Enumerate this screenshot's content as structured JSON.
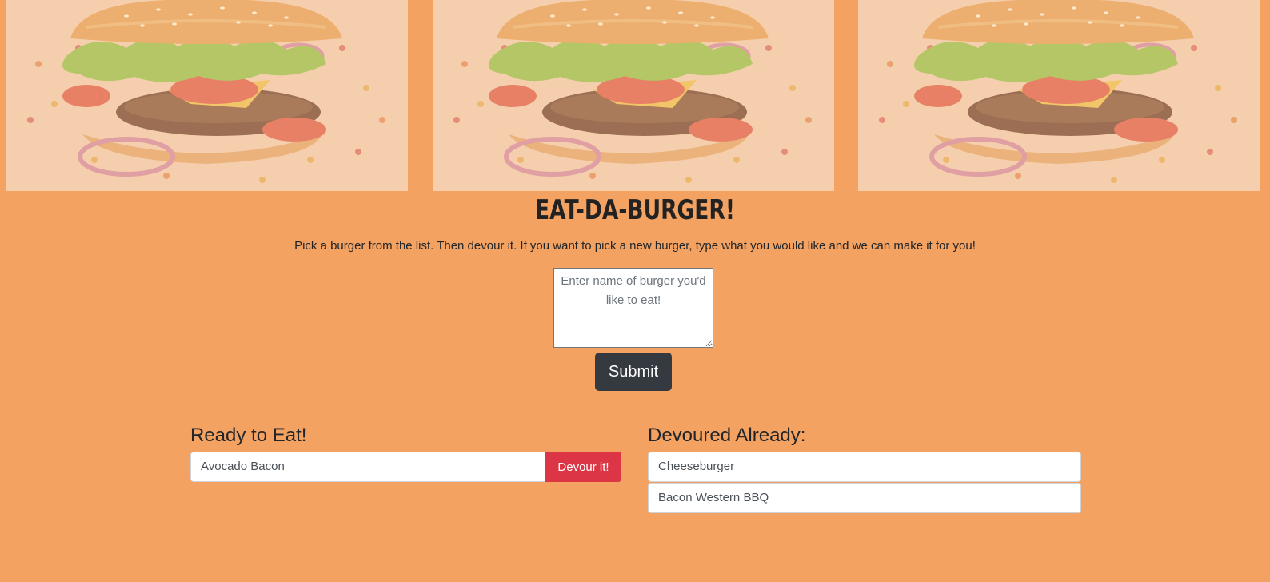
{
  "banner": {
    "image_alt": "burger"
  },
  "header": {
    "title": "EAT-DA-BURGER!",
    "subtitle": "Pick a burger from the list. Then devour it. If you want to pick a new burger, type what you would like and we can make it for you!"
  },
  "form": {
    "placeholder": "Enter name of burger you'd like to eat!",
    "value": "",
    "submit_label": "Submit"
  },
  "ready": {
    "heading": "Ready to Eat!",
    "items": [
      {
        "name": "Avocado Bacon",
        "action_label": "Devour it!"
      }
    ]
  },
  "devoured": {
    "heading": "Devoured Already:",
    "items": [
      {
        "name": "Cheeseburger"
      },
      {
        "name": "Bacon Western BBQ"
      }
    ]
  },
  "colors": {
    "background": "#f4a261",
    "submit_button": "#343a40",
    "devour_button": "#dc3545"
  }
}
